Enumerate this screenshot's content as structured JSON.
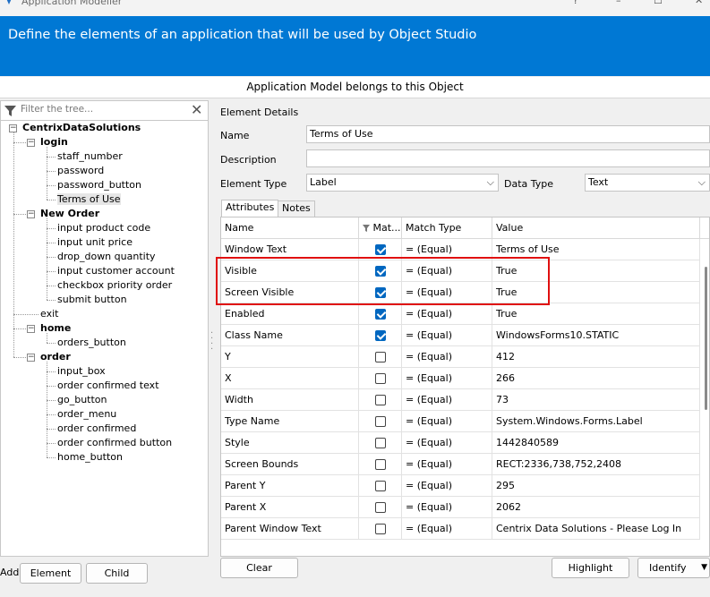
{
  "window": {
    "title": "Application Modeller",
    "controls": [
      "?",
      "–",
      "☐",
      "✕"
    ]
  },
  "banner": {
    "text": "Define the elements of an application that will be used by Object Studio",
    "color": "#0078d4"
  },
  "belongs_label": "Application Model belongs to this Object",
  "filter": {
    "placeholder": "Filter the tree...",
    "icon": "funnel-icon",
    "clear_icon": "close-icon"
  },
  "tree": {
    "root": "CentrixDataSolutions",
    "nodes": [
      {
        "label": "login",
        "bold": true,
        "children": [
          "staff_number",
          "password",
          "password_button",
          "Terms of Use"
        ]
      },
      {
        "label": "New Order",
        "bold": true,
        "children": [
          "input product code",
          "input unit price",
          "drop_down quantity",
          "input customer account",
          "checkbox priority order",
          "submit button"
        ]
      },
      {
        "label": "exit",
        "bold": false,
        "children": []
      },
      {
        "label": "home",
        "bold": true,
        "children": [
          "orders_button"
        ]
      },
      {
        "label": "order",
        "bold": true,
        "children": [
          "input_box",
          "order confirmed text",
          "go_button",
          "order_menu",
          "order confirmed",
          "order confirmed button",
          "home_button"
        ]
      }
    ],
    "selected": "Terms of Use"
  },
  "left_buttons": {
    "add": "Add",
    "element": "Element",
    "child": "Child"
  },
  "details": {
    "section_title": "Element Details",
    "name_label": "Name",
    "name_value": "Terms of Use",
    "description_label": "Description",
    "description_value": "",
    "element_type_label": "Element Type",
    "element_type_value": "Label",
    "data_type_label": "Data Type",
    "data_type_value": "Text"
  },
  "tabs": [
    "Attributes",
    "Notes"
  ],
  "grid": {
    "headers": [
      "Name",
      "Mat...",
      "Match Type",
      "Value"
    ],
    "rows": [
      {
        "name": "Window Text",
        "match": true,
        "type": "= (Equal)",
        "value": "Terms of Use"
      },
      {
        "name": "Visible",
        "match": true,
        "type": "= (Equal)",
        "value": "True"
      },
      {
        "name": "Screen Visible",
        "match": true,
        "type": "= (Equal)",
        "value": "True"
      },
      {
        "name": "Enabled",
        "match": true,
        "type": "= (Equal)",
        "value": "True"
      },
      {
        "name": "Class Name",
        "match": true,
        "type": "= (Equal)",
        "value": "WindowsForms10.STATIC"
      },
      {
        "name": "Y",
        "match": false,
        "type": "= (Equal)",
        "value": "412"
      },
      {
        "name": "X",
        "match": false,
        "type": "= (Equal)",
        "value": "266"
      },
      {
        "name": "Width",
        "match": false,
        "type": "= (Equal)",
        "value": "73"
      },
      {
        "name": "Type Name",
        "match": false,
        "type": "= (Equal)",
        "value": "System.Windows.Forms.Label"
      },
      {
        "name": "Style",
        "match": false,
        "type": "= (Equal)",
        "value": "1442840589"
      },
      {
        "name": "Screen Bounds",
        "match": false,
        "type": "= (Equal)",
        "value": "RECT:2336,738,752,2408"
      },
      {
        "name": "Parent Y",
        "match": false,
        "type": "= (Equal)",
        "value": "295"
      },
      {
        "name": "Parent X",
        "match": false,
        "type": "= (Equal)",
        "value": "2062"
      },
      {
        "name": "Parent Window Text",
        "match": false,
        "type": "= (Equal)",
        "value": "Centrix Data Solutions - Please Log In"
      }
    ]
  },
  "bottom_buttons": {
    "clear": "Clear",
    "highlight": "Highlight",
    "identify": "Identify"
  },
  "annotation_color": "#e01010"
}
